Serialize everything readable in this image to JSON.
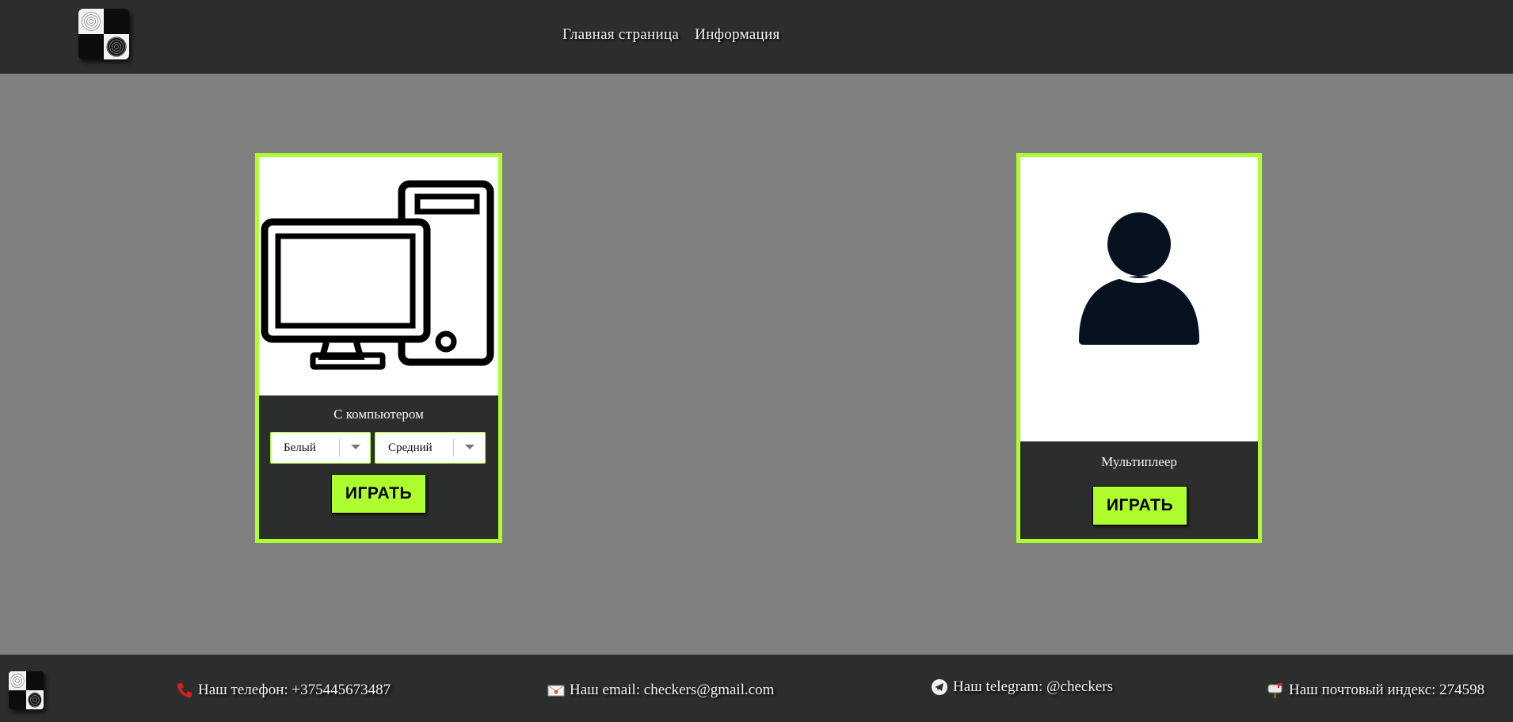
{
  "header": {
    "nav": [
      {
        "label": "Главная страница"
      },
      {
        "label": "Информация"
      }
    ]
  },
  "cards": {
    "computer": {
      "title": "С компьютером",
      "color_select": {
        "value": "Белый"
      },
      "level_select": {
        "value": "Средний"
      },
      "play_label": "ИГРАТЬ"
    },
    "multiplayer": {
      "title": "Мультиплеер",
      "play_label": "ИГРАТЬ"
    }
  },
  "footer": {
    "phone": "Наш телефон: +375445673487",
    "email": "Наш email: checkers@gmail.com",
    "telegram": "Наш telegram: @checkers",
    "postal": "Наш почтовый индекс: 274598"
  },
  "colors": {
    "accent": "#adfd2f",
    "bar": "#2c2e2d",
    "background": "#808080"
  },
  "icons": [
    "checkers-logo-icon",
    "computer-icon",
    "user-icon",
    "phone-icon",
    "email-icon",
    "telegram-icon",
    "mailbox-icon"
  ]
}
